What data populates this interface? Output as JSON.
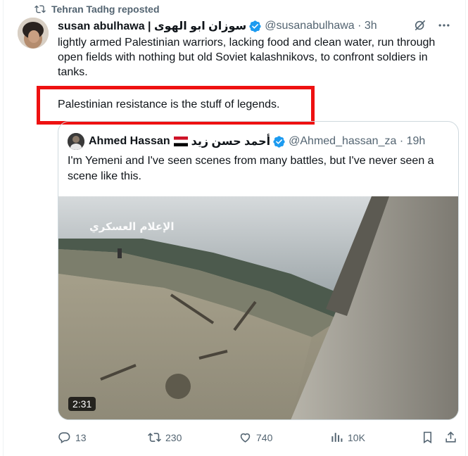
{
  "repost": {
    "label": "Tehran Tadhg reposted"
  },
  "tweet": {
    "author_name": "susan abulhawa | سوزان ابو الهوى",
    "handle_time": "@susanabulhawa · 3h",
    "text": "lightly armed Palestinian warriors, lacking food and clean water, run through open fields with nothing but old Soviet kalashnikovs, to confront soldiers in tanks.",
    "highlight_text": "Palestinian resistance is the stuff of legends."
  },
  "quote": {
    "author_name": "Ahmed Hassan",
    "author_name_ar": "أحمد حسن زيد",
    "handle_time": "@Ahmed_hassan_za · 19h",
    "text": "I'm Yemeni and I've seen scenes from many battles, but I've never seen a scene like this.",
    "video_duration": "2:31",
    "watermark": "الإعلام العسكري"
  },
  "actions": {
    "replies": "13",
    "reposts": "230",
    "likes": "740",
    "views": "10K"
  },
  "colors": {
    "verified": "#1d9bf0",
    "highlight_border": "#ee1111",
    "muted": "#536471"
  }
}
